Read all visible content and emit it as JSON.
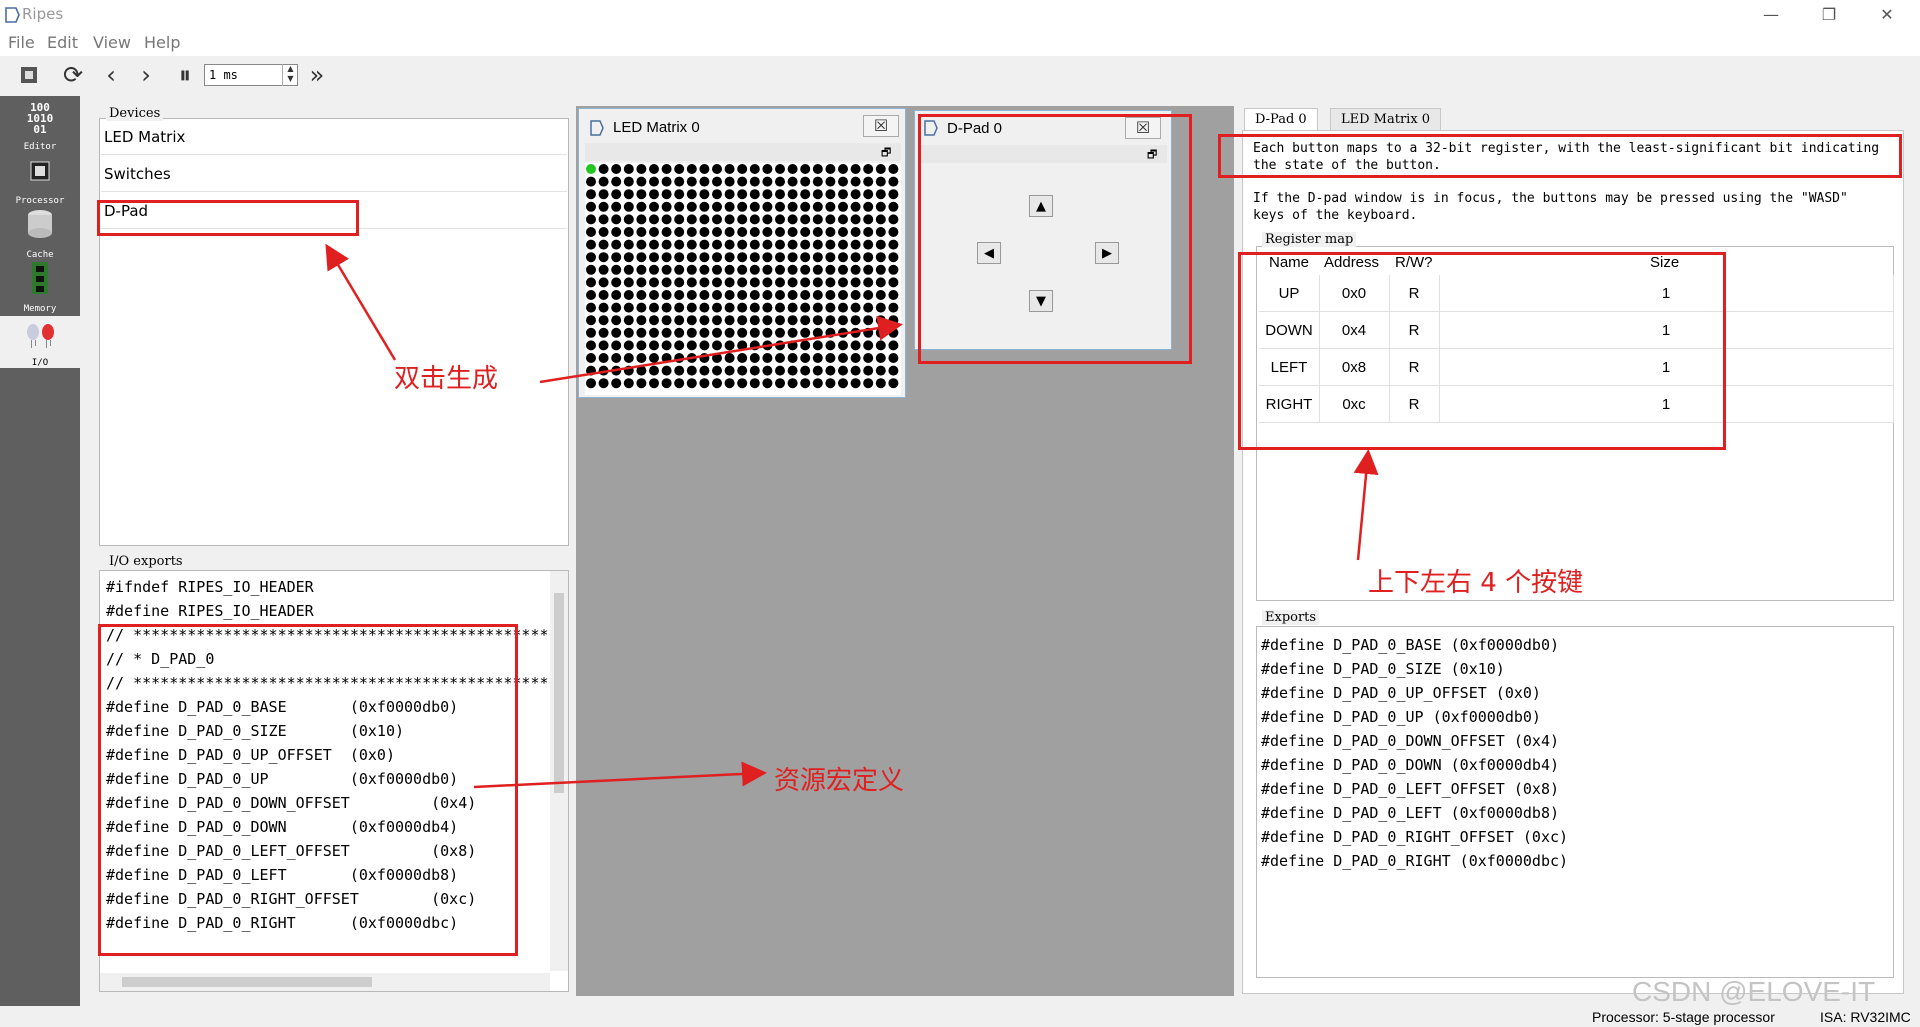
{
  "window": {
    "title": "Ripes",
    "minimize": "—",
    "restore": "❐",
    "close": "✕"
  },
  "menu": [
    "File",
    "Edit",
    "View",
    "Help"
  ],
  "toolbar": {
    "speed_value": "1 ms",
    "speed_up": "▲",
    "speed_down": "▼"
  },
  "sidebar": [
    {
      "label": "Editor",
      "icon": "binary-editor-icon",
      "glyph": "100\n1010\n01"
    },
    {
      "label": "Processor",
      "icon": "chip-icon",
      "glyph": "▦"
    },
    {
      "label": "Cache",
      "icon": "cache-icon",
      "glyph": "⛁"
    },
    {
      "label": "Memory",
      "icon": "memory-icon",
      "glyph": "▥"
    },
    {
      "label": "I/O",
      "icon": "io-leds-icon",
      "glyph": ""
    }
  ],
  "devices": {
    "title": "Devices",
    "items": [
      "LED Matrix",
      "Switches",
      "D-Pad"
    ]
  },
  "io_exports": {
    "title": "I/O exports",
    "lines": [
      "#ifndef RIPES_IO_HEADER",
      "#define RIPES_IO_HEADER",
      "// ***************************************************",
      "// * D_PAD_0",
      "// ***************************************************",
      "#define D_PAD_0_BASE       (0xf0000db0)",
      "#define D_PAD_0_SIZE       (0x10)",
      "#define D_PAD_0_UP_OFFSET  (0x0)",
      "#define D_PAD_0_UP         (0xf0000db0)",
      "#define D_PAD_0_DOWN_OFFSET         (0x4)",
      "#define D_PAD_0_DOWN       (0xf0000db4)",
      "#define D_PAD_0_LEFT_OFFSET         (0x8)",
      "#define D_PAD_0_LEFT       (0xf0000db8)",
      "#define D_PAD_0_RIGHT_OFFSET        (0xc)",
      "#define D_PAD_0_RIGHT      (0xf0000dbc)"
    ]
  },
  "led_window": {
    "title": "LED Matrix 0",
    "cols": 25,
    "rows": 18,
    "on_color": "#22c622",
    "off_color": "#000000"
  },
  "dpad_window": {
    "title": "D-Pad 0",
    "up": "▲",
    "down": "▼",
    "left": "◀",
    "right": "▶"
  },
  "right_panel": {
    "tabs": [
      "D-Pad 0",
      "LED Matrix 0"
    ],
    "desc1": "Each button maps to a 32-bit register, with the least-significant bit indicating\nthe state of the button.",
    "desc2": "If the D-pad window is in focus, the buttons may be pressed using the \"WASD\"\nkeys of the keyboard.",
    "register_map_title": "Register map",
    "headers": [
      "Name",
      "Address",
      "R/W?",
      "Size"
    ],
    "rows": [
      [
        "UP",
        "0x0",
        "R",
        "1"
      ],
      [
        "DOWN",
        "0x4",
        "R",
        "1"
      ],
      [
        "LEFT",
        "0x8",
        "R",
        "1"
      ],
      [
        "RIGHT",
        "0xc",
        "R",
        "1"
      ]
    ],
    "exports_title": "Exports",
    "exports": [
      "#define D_PAD_0_BASE (0xf0000db0)",
      "#define D_PAD_0_SIZE (0x10)",
      "#define D_PAD_0_UP_OFFSET (0x0)",
      "#define D_PAD_0_UP (0xf0000db0)",
      "#define D_PAD_0_DOWN_OFFSET (0x4)",
      "#define D_PAD_0_DOWN (0xf0000db4)",
      "#define D_PAD_0_LEFT_OFFSET (0x8)",
      "#define D_PAD_0_LEFT (0xf0000db8)",
      "#define D_PAD_0_RIGHT_OFFSET (0xc)",
      "#define D_PAD_0_RIGHT (0xf0000dbc)"
    ]
  },
  "annotations": {
    "double_click": "双击生成",
    "macros": "资源宏定义",
    "buttons": "上下左右 4 个按键",
    "color": "#e02020"
  },
  "status": {
    "processor": "Processor: 5-stage processor",
    "isa": "ISA: RV32IMC",
    "watermark": "CSDN @ELOVE-IT"
  }
}
